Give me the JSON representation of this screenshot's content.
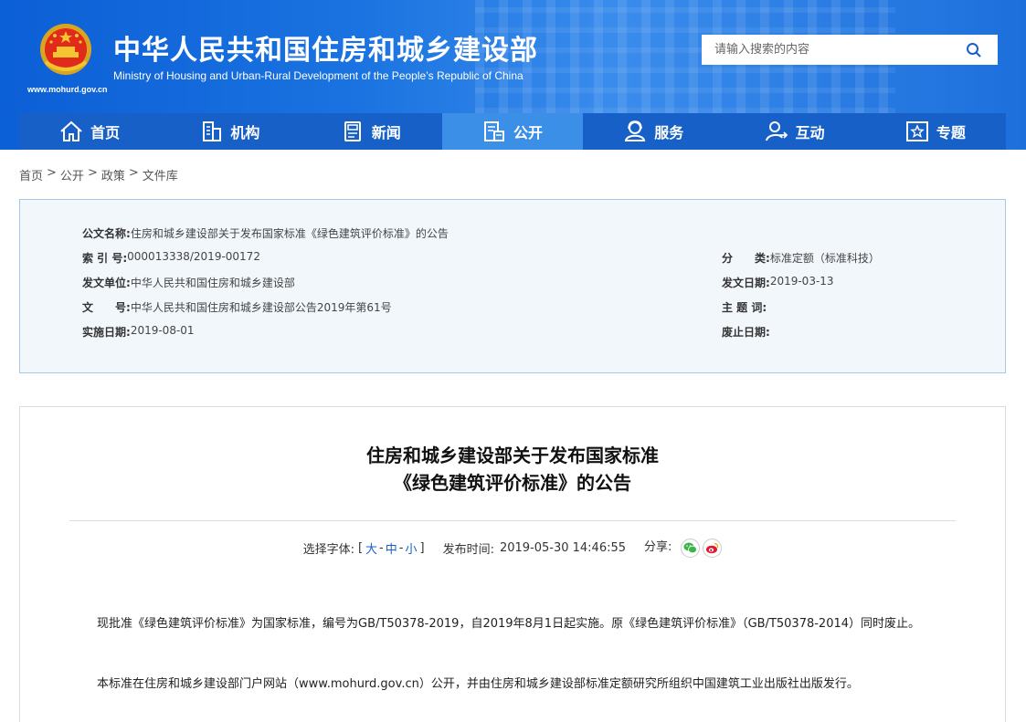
{
  "header": {
    "site_title": "中华人民共和国住房和城乡建设部",
    "site_subtitle": "Ministry of Housing and Urban-Rural Development of the People’s Republic of China",
    "site_url": "www.mohurd.gov.cn",
    "search_placeholder": "请输入搜索的内容",
    "colors": {
      "brand_blue": "#1760c7",
      "nav_active": "#3b8fe6"
    }
  },
  "nav": {
    "items": [
      {
        "label": "首页",
        "icon": "home-icon"
      },
      {
        "label": "机构",
        "icon": "building-icon"
      },
      {
        "label": "新闻",
        "icon": "news-icon"
      },
      {
        "label": "公开",
        "icon": "document-icon",
        "active": true
      },
      {
        "label": "服务",
        "icon": "user-service-icon"
      },
      {
        "label": "互动",
        "icon": "interaction-icon"
      },
      {
        "label": "专题",
        "icon": "star-icon"
      }
    ]
  },
  "breadcrumb": {
    "items": [
      "首页",
      "公开",
      "政策",
      "文件库"
    ],
    "separator": ">"
  },
  "info": {
    "doc_name_label": "公文名称:",
    "doc_name_value": "住房和城乡建设部关于发布国家标准《绿色建筑评价标准》的公告",
    "index_label": "索 引 号:",
    "index_value": "000013338/2019-00172",
    "category_label": "分　　类:",
    "category_value": "标准定额（标准科技）",
    "issuer_label": "发文单位:",
    "issuer_value": "中华人民共和国住房和城乡建设部",
    "issue_date_label": "发文日期:",
    "issue_date_value": "2019-03-13",
    "doc_no_label": "文　　号:",
    "doc_no_value": "中华人民共和国住房和城乡建设部公告2019年第61号",
    "subject_label": "主 题 词:",
    "subject_value": "",
    "effective_label": "实施日期:",
    "effective_value": "2019-08-01",
    "abolish_label": "废止日期:",
    "abolish_value": ""
  },
  "article": {
    "title_line1": "住房和城乡建设部关于发布国家标准",
    "title_line2": "《绿色建筑评价标准》的公告",
    "font_label": "选择字体:",
    "bracket_open": "[",
    "font_large": "大",
    "font_medium": "中",
    "font_small": "小",
    "dash": "-",
    "bracket_close": "]",
    "publish_label": "发布时间:",
    "publish_time": "2019-05-30 14:46:55",
    "share_label": "分享:",
    "paragraph1": "现批准《绿色建筑评价标准》为国家标准，编号为GB/T50378-2019，自2019年8月1日起实施。原《绿色建筑评价标准》（GB/T50378-2014）同时废止。",
    "paragraph2": "本标准在住房和城乡建设部门户网站（www.mohurd.gov.cn）公开，并由住房和城乡建设部标准定额研究所组织中国建筑工业出版社出版发行。"
  }
}
